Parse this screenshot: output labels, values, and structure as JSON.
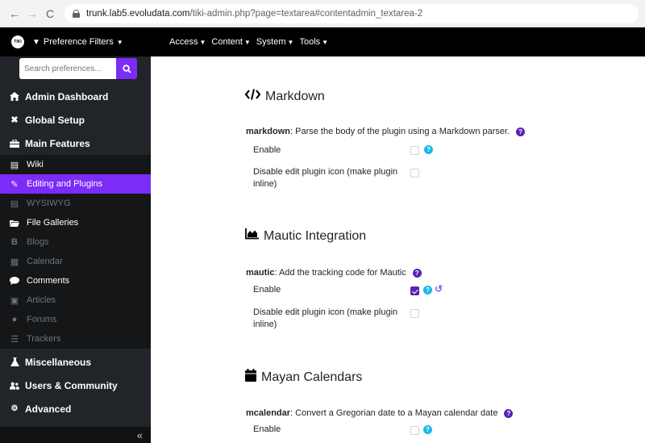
{
  "browser": {
    "url_host": "trunk.lab5.evoludata.com",
    "url_path": "/tiki-admin.php?page=textarea#contentadmin_textarea-2"
  },
  "topnav": {
    "pref_filters": "Preference Filters",
    "menus": [
      "Access",
      "Content",
      "System",
      "Tools"
    ]
  },
  "sidebar": {
    "search_placeholder": "Search preferences...",
    "top": [
      "Admin Dashboard",
      "Global Setup",
      "Main Features"
    ],
    "sub": [
      {
        "label": "Wiki",
        "icon": "file-icon",
        "state": "normal"
      },
      {
        "label": "Editing and Plugins",
        "icon": "edit-icon",
        "state": "active"
      },
      {
        "label": "WYSIWYG",
        "icon": "file-icon",
        "state": "dim"
      },
      {
        "label": "File Galleries",
        "icon": "folder-icon",
        "state": "normal"
      },
      {
        "label": "Blogs",
        "icon": "bold-icon",
        "state": "dim"
      },
      {
        "label": "Calendar",
        "icon": "calendar-icon",
        "state": "dim"
      },
      {
        "label": "Comments",
        "icon": "comment-icon",
        "state": "normal"
      },
      {
        "label": "Articles",
        "icon": "newspaper-icon",
        "state": "dim"
      },
      {
        "label": "Forums",
        "icon": "forums-icon",
        "state": "dim"
      },
      {
        "label": "Trackers",
        "icon": "database-icon",
        "state": "dim"
      }
    ],
    "bottom": [
      "Miscellaneous",
      "Users & Community",
      "Advanced"
    ],
    "collapse": "«"
  },
  "sections": [
    {
      "title": "Markdown",
      "icon": "code-icon",
      "pref_name": "markdown",
      "pref_desc": ": Parse the body of the plugin using a Markdown parser.",
      "enable_label": "Enable",
      "enable_checked": false,
      "disable_label": "Disable edit plugin icon (make plugin inline)"
    },
    {
      "title": "Mautic Integration",
      "icon": "area-chart-icon",
      "pref_name": "mautic",
      "pref_desc": ": Add the tracking code for Mautic",
      "enable_label": "Enable",
      "enable_checked": true,
      "disable_label": "Disable edit plugin icon (make plugin inline)"
    },
    {
      "title": "Mayan Calendars",
      "icon": "calendar-icon",
      "pref_name": "mcalendar",
      "pref_desc": ": Convert a Gregorian date to a Mayan calendar date",
      "enable_label": "Enable",
      "enable_checked": false
    }
  ],
  "colors": {
    "accent": "#7b2cf6",
    "help": "#1ab7ea",
    "sidebar": "#212529"
  }
}
